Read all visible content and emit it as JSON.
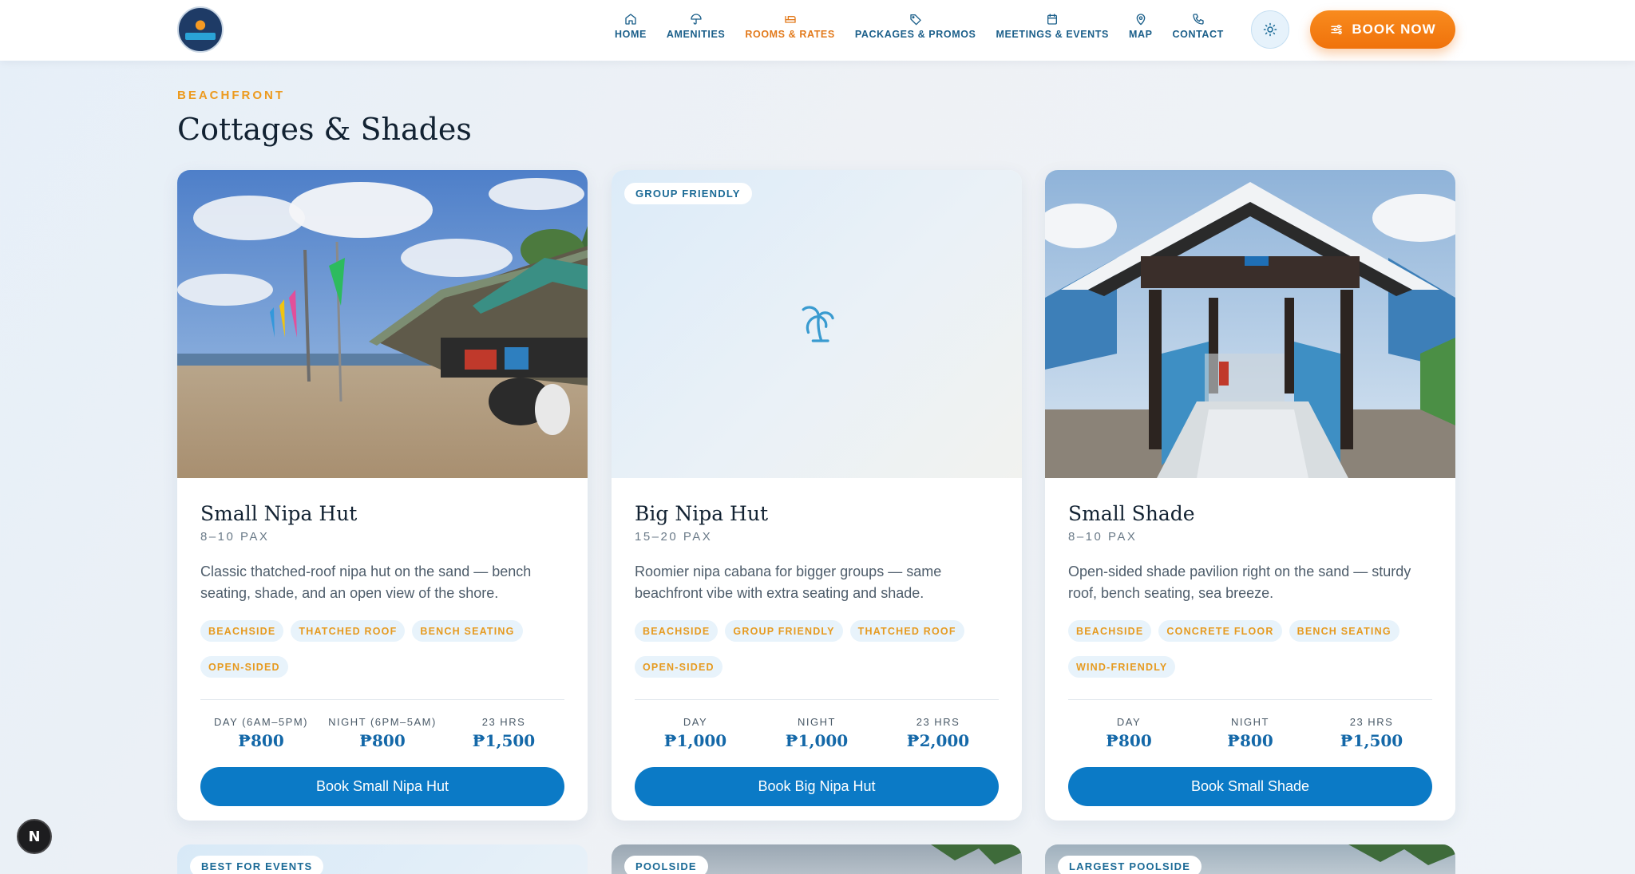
{
  "nav": {
    "items": [
      {
        "label": "HOME",
        "icon": "home-icon"
      },
      {
        "label": "AMENITIES",
        "icon": "umbrella-icon"
      },
      {
        "label": "ROOMS & RATES",
        "icon": "bed-icon",
        "active": true
      },
      {
        "label": "PACKAGES & PROMOS",
        "icon": "tag-icon"
      },
      {
        "label": "MEETINGS & EVENTS",
        "icon": "calendar-icon"
      },
      {
        "label": "MAP",
        "icon": "map-pin-icon"
      },
      {
        "label": "CONTACT",
        "icon": "phone-icon"
      }
    ],
    "theme_icon": "sun-icon",
    "book_now": "BOOK NOW",
    "colors": {
      "accent": "#e27a1c",
      "nav_text": "#1b5f8a",
      "book_now_bg": "#f0720b"
    }
  },
  "section": {
    "eyebrow": "BEACHFRONT",
    "title": "Cottages & Shades"
  },
  "cards": [
    {
      "name": "Small Nipa Hut",
      "pax": "8–10 PAX",
      "description": "Classic thatched-roof nipa hut on the sand — bench seating, shade, and an open view of the shore.",
      "tags": [
        "BEACHSIDE",
        "THATCHED ROOF",
        "BENCH SEATING",
        "OPEN-SIDED"
      ],
      "rates": [
        {
          "label": "DAY (6AM–5PM)",
          "price": "₱800"
        },
        {
          "label": "NIGHT (6PM–5AM)",
          "price": "₱800"
        },
        {
          "label": "23 HRS",
          "price": "₱1,500"
        }
      ],
      "button": "Book Small Nipa Hut"
    },
    {
      "badge": "GROUP FRIENDLY",
      "name": "Big Nipa Hut",
      "pax": "15–20 PAX",
      "description": "Roomier nipa cabana for bigger groups — same beachfront vibe with extra seating and shade.",
      "tags": [
        "BEACHSIDE",
        "GROUP FRIENDLY",
        "THATCHED ROOF",
        "OPEN-SIDED"
      ],
      "rates": [
        {
          "label": "DAY",
          "price": "₱1,000"
        },
        {
          "label": "NIGHT",
          "price": "₱1,000"
        },
        {
          "label": "23 HRS",
          "price": "₱2,000"
        }
      ],
      "button": "Book Big Nipa Hut"
    },
    {
      "name": "Small Shade",
      "pax": "8–10 PAX",
      "description": "Open-sided shade pavilion right on the sand — sturdy roof, bench seating, sea breeze.",
      "tags": [
        "BEACHSIDE",
        "CONCRETE FLOOR",
        "BENCH SEATING",
        "WIND-FRIENDLY"
      ],
      "rates": [
        {
          "label": "DAY",
          "price": "₱800"
        },
        {
          "label": "NIGHT",
          "price": "₱800"
        },
        {
          "label": "23 HRS",
          "price": "₱1,500"
        }
      ],
      "button": "Book Small Shade"
    }
  ],
  "next_row": [
    {
      "badge": "BEST FOR EVENTS"
    },
    {
      "badge": "POOLSIDE"
    },
    {
      "badge": "LARGEST POOLSIDE"
    }
  ],
  "dev_badge": "N"
}
